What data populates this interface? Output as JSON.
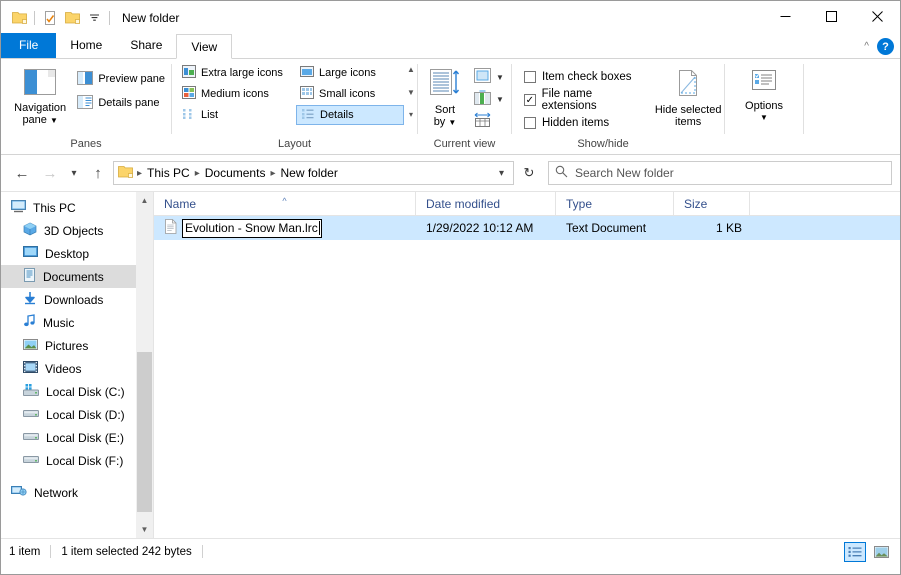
{
  "window": {
    "title": "New folder",
    "quick_access": [
      "folder-icon",
      "properties-icon",
      "new-folder-icon",
      "dropdown-icon"
    ],
    "controls": {
      "minimize": "minimize-icon",
      "maximize": "maximize-icon",
      "close": "close-icon"
    }
  },
  "ribbon": {
    "tabs": [
      {
        "label": "File",
        "id": "file"
      },
      {
        "label": "Home",
        "id": "home"
      },
      {
        "label": "Share",
        "id": "share"
      },
      {
        "label": "View",
        "id": "view"
      }
    ],
    "active_tab": "View",
    "help_label": "?",
    "groups": {
      "panes": {
        "label": "Panes",
        "navigation_pane": "Navigation\npane",
        "navigation_pane_line1": "Navigation",
        "navigation_pane_line2": "pane",
        "preview_pane": "Preview pane",
        "details_pane": "Details pane"
      },
      "layout": {
        "label": "Layout",
        "items": [
          {
            "label": "Extra large icons",
            "selected": false
          },
          {
            "label": "Large icons",
            "selected": false
          },
          {
            "label": "Medium icons",
            "selected": false
          },
          {
            "label": "Small icons",
            "selected": false
          },
          {
            "label": "List",
            "selected": false
          },
          {
            "label": "Details",
            "selected": true
          }
        ]
      },
      "current_view": {
        "label": "Current view",
        "sort_by_line1": "Sort",
        "sort_by_line2": "by"
      },
      "show_hide": {
        "label": "Show/hide",
        "checkboxes": [
          {
            "label": "Item check boxes",
            "checked": false
          },
          {
            "label": "File name extensions",
            "checked": true
          },
          {
            "label": "Hidden items",
            "checked": false
          }
        ],
        "hide_selected_line1": "Hide selected",
        "hide_selected_line2": "items"
      },
      "options": {
        "label": "Options"
      }
    }
  },
  "address": {
    "back": "back-arrow",
    "forward": "forward-arrow",
    "recent": "recent-locations",
    "up": "up-arrow",
    "breadcrumbs": [
      "This PC",
      "Documents",
      "New folder"
    ],
    "refresh": "refresh-icon"
  },
  "search": {
    "placeholder": "Search New folder",
    "value": ""
  },
  "sidebar": {
    "items": [
      {
        "label": "This PC",
        "icon": "pc-icon",
        "root": true,
        "selected": false
      },
      {
        "label": "3D Objects",
        "icon": "3d-objects-icon",
        "selected": false
      },
      {
        "label": "Desktop",
        "icon": "desktop-icon",
        "selected": false
      },
      {
        "label": "Documents",
        "icon": "documents-icon",
        "selected": true
      },
      {
        "label": "Downloads",
        "icon": "downloads-icon",
        "selected": false
      },
      {
        "label": "Music",
        "icon": "music-icon",
        "selected": false
      },
      {
        "label": "Pictures",
        "icon": "pictures-icon",
        "selected": false
      },
      {
        "label": "Videos",
        "icon": "videos-icon",
        "selected": false
      },
      {
        "label": "Local Disk (C:)",
        "icon": "system-drive-icon",
        "selected": false
      },
      {
        "label": "Local Disk (D:)",
        "icon": "drive-icon",
        "selected": false
      },
      {
        "label": "Local Disk (E:)",
        "icon": "drive-icon",
        "selected": false
      },
      {
        "label": "Local Disk (F:)",
        "icon": "drive-icon",
        "selected": false
      },
      {
        "label": "Network",
        "icon": "network-icon",
        "root": true,
        "gap": true,
        "selected": false
      }
    ]
  },
  "filelist": {
    "columns": [
      {
        "label": "Name",
        "sorted": "asc"
      },
      {
        "label": "Date modified",
        "sorted": ""
      },
      {
        "label": "Type",
        "sorted": ""
      },
      {
        "label": "Size",
        "sorted": ""
      }
    ],
    "rows": [
      {
        "name": "Evolution - Snow Man.lrc",
        "date_modified": "1/29/2022 10:12 AM",
        "type": "Text Document",
        "size": "1 KB",
        "selected": true,
        "renaming": true,
        "icon": "text-document-icon"
      }
    ]
  },
  "statusbar": {
    "item_count": "1 item",
    "selection": "1 item selected  242 bytes",
    "view_details": "details-view-icon",
    "view_thumbnails": "thumbnail-view-icon",
    "active_view": "details"
  },
  "colors": {
    "accent": "#0078d7",
    "selection": "#cde8ff",
    "sidebar_selection": "#dcdcdc",
    "header_text": "#34508c"
  }
}
